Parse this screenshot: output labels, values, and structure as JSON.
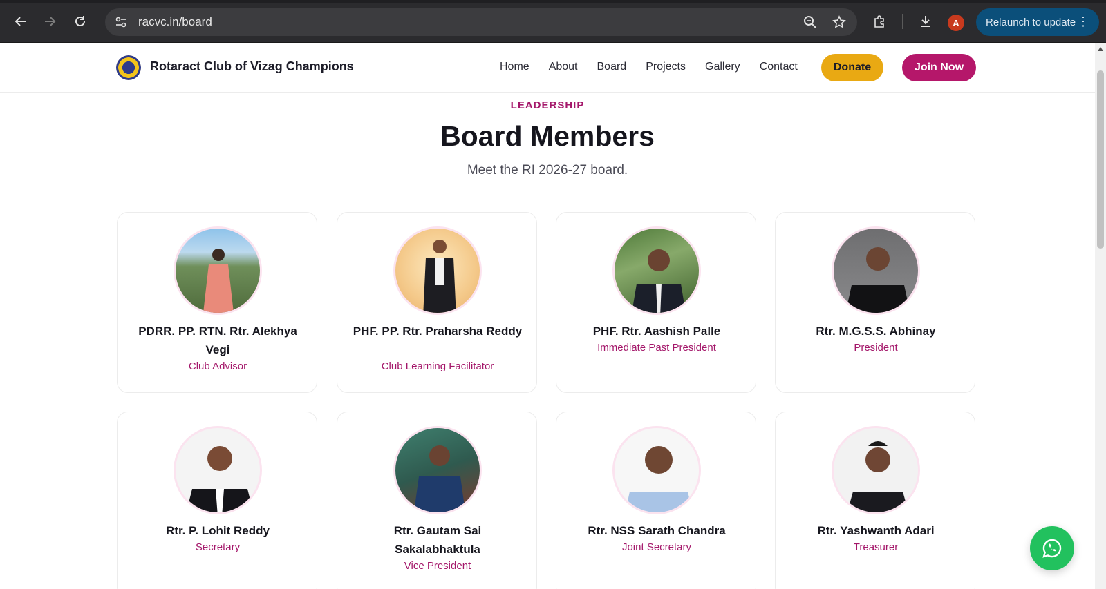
{
  "browser": {
    "url": "racvc.in/board",
    "profile_initial": "A",
    "relaunch_label": "Relaunch to update"
  },
  "site": {
    "brand": "Rotaract Club of Vizag Champions",
    "nav": [
      "Home",
      "About",
      "Board",
      "Projects",
      "Gallery",
      "Contact"
    ],
    "donate_label": "Donate",
    "join_label": "Join Now"
  },
  "section": {
    "eyebrow": "LEADERSHIP",
    "title": "Board Members",
    "subtitle": "Meet the RI 2026-27 board."
  },
  "members": [
    {
      "name": "PDRR. PP. RTN. Rtr. Alekhya Vegi",
      "role": "Club Advisor"
    },
    {
      "name": "PHF. PP. Rtr. Praharsha Reddy",
      "role": "Club Learning Facilitator"
    },
    {
      "name": "PHF. Rtr. Aashish Palle",
      "role": "Immediate Past President"
    },
    {
      "name": "Rtr. M.G.S.S. Abhinay",
      "role": "President"
    },
    {
      "name": "Rtr. P. Lohit Reddy",
      "role": "Secretary"
    },
    {
      "name": "Rtr. Gautam Sai Sakalabhaktula",
      "role": "Vice President"
    },
    {
      "name": "Rtr. NSS Sarath Chandra",
      "role": "Joint Secretary"
    },
    {
      "name": "Rtr. Yashwanth Adari",
      "role": "Treasurer"
    }
  ],
  "colors": {
    "accent": "#a4176a",
    "donate": "#e9a913",
    "join": "#b5176a",
    "whatsapp": "#22c15e"
  }
}
